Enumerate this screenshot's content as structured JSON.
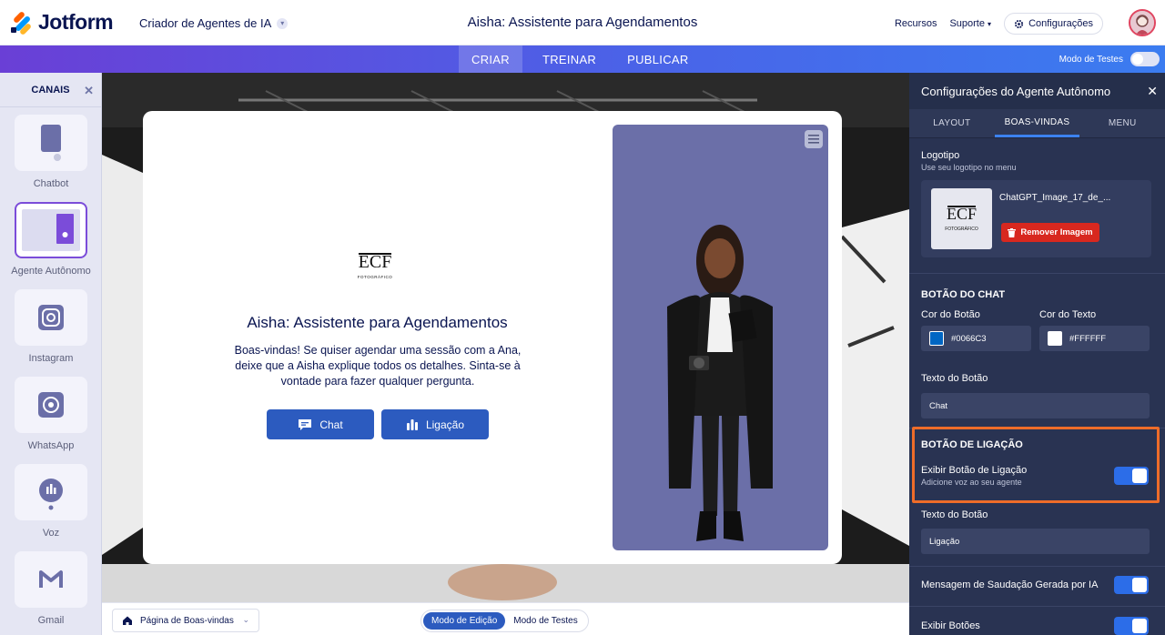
{
  "header": {
    "brand": "Jotform",
    "app_name": "Criador de Agentes de IA",
    "page_title": "Aisha: Assistente para Agendamentos",
    "resources": "Recursos",
    "support": "Suporte",
    "settings": "Configurações"
  },
  "nav": {
    "tabs": [
      {
        "label": "CRIAR",
        "active": true
      },
      {
        "label": "TREINAR",
        "active": false
      },
      {
        "label": "PUBLICAR",
        "active": false
      }
    ],
    "test_mode_label": "Modo de Testes"
  },
  "sidebar": {
    "title": "CANAIS",
    "items": [
      {
        "label": "Chatbot",
        "icon": "phone-chat-icon",
        "active": false
      },
      {
        "label": "Agente Autônomo",
        "icon": "autonomous-agent-icon",
        "active": true
      },
      {
        "label": "Instagram",
        "icon": "instagram-icon",
        "active": false
      },
      {
        "label": "WhatsApp",
        "icon": "whatsapp-icon",
        "active": false
      },
      {
        "label": "Voz",
        "icon": "voice-icon",
        "active": false
      },
      {
        "label": "Gmail",
        "icon": "gmail-icon",
        "active": false
      }
    ]
  },
  "preview": {
    "logo_text": "ECF",
    "logo_sub": "FOTOGRÁFICO",
    "title": "Aisha: Assistente para Agendamentos",
    "description": "Boas-vindas! Se quiser agendar uma sessão com a Ana, deixe que a Aisha explique todos os detalhes. Sinta-se à vontade para fazer qualquer pergunta.",
    "chat_button": "Chat",
    "call_button": "Ligação"
  },
  "bottom": {
    "page_select": "Página de Boas-vindas",
    "edit_mode": "Modo de Edição",
    "test_mode": "Modo de Testes"
  },
  "panel": {
    "title": "Configurações do Agente Autônomo",
    "tabs": [
      {
        "label": "LAYOUT",
        "active": false
      },
      {
        "label": "BOAS-VINDAS",
        "active": true
      },
      {
        "label": "MENU",
        "active": false
      }
    ],
    "logo_label": "Logotipo",
    "logo_sub": "Use seu logotipo no menu",
    "logo_filename": "ChatGPT_Image_17_de_...",
    "remove_image": "Remover Imagem",
    "chat_button_section": "BOTÃO DO CHAT",
    "button_color_label": "Cor do Botão",
    "button_color": "#0066C3",
    "text_color_label": "Cor do Texto",
    "text_color": "#FFFFFF",
    "button_text_label": "Texto do Botão",
    "button_text_value": "Chat",
    "call_section": "BOTÃO DE LIGAÇÃO",
    "show_call_label": "Exibir Botão de Ligação",
    "show_call_sub": "Adicione voz ao seu agente",
    "call_text_label": "Texto do Botão",
    "call_text_value": "Ligação",
    "ai_greeting_label": "Mensagem de Saudação Gerada por IA",
    "show_buttons_label": "Exibir Botões"
  },
  "colors": {
    "accent": "#2c5bbf",
    "highlight": "#ee6c29",
    "panel_bg": "#293352"
  }
}
